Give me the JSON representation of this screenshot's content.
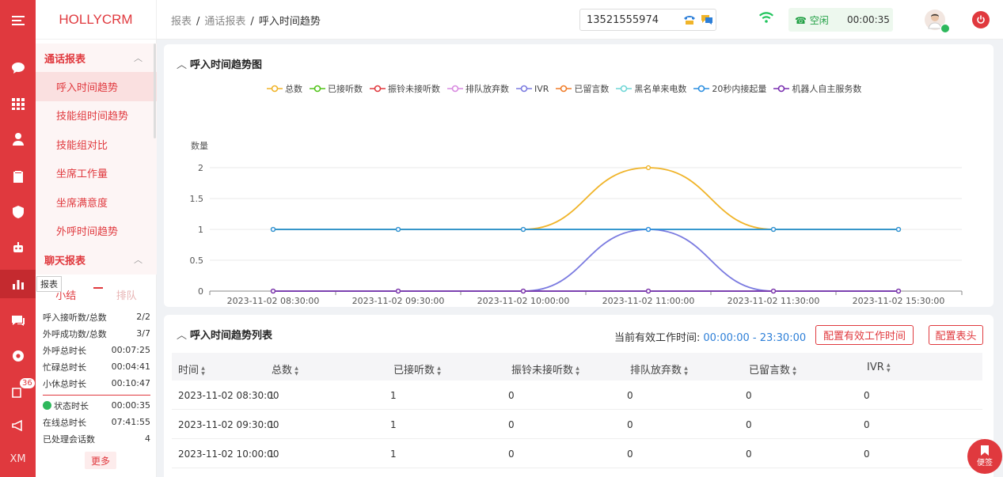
{
  "app": {
    "logo": "HOLLYCRM"
  },
  "rail": {
    "badge": "36",
    "footer": "XM"
  },
  "breadcrumb": {
    "items": [
      "报表",
      "通话报表"
    ],
    "current": "呼入时间趋势"
  },
  "topbar": {
    "phone": "13521555974",
    "status": "空闲",
    "timer": "00:00:35"
  },
  "menu": {
    "group1": "通话报表",
    "items": [
      "呼入时间趋势",
      "技能组时间趋势",
      "技能组对比",
      "坐席工作量",
      "坐席满意度",
      "外呼时间趋势"
    ],
    "group2": "聊天报表"
  },
  "tooltip": "报表",
  "summary": {
    "tabs": [
      "小结",
      "排队"
    ],
    "rows": [
      {
        "label": "呼入接听数/总数",
        "value": "2/2"
      },
      {
        "label": "外呼成功数/总数",
        "value": "3/7"
      },
      {
        "label": "外呼总时长",
        "value": "00:07:25"
      },
      {
        "label": "忙碌总时长",
        "value": "00:04:41"
      },
      {
        "label": "小休总时长",
        "value": "00:10:47"
      }
    ],
    "rows2": [
      {
        "label": "状态时长",
        "value": "00:00:35"
      },
      {
        "label": "在线总时长",
        "value": "07:41:55"
      },
      {
        "label": "已处理会话数",
        "value": "4"
      }
    ],
    "more": "更多"
  },
  "chart_panel": {
    "title": "呼入时间趋势图"
  },
  "chart_data": {
    "type": "line",
    "ylabel": "数量",
    "ylim": [
      0,
      2
    ],
    "yticks": [
      "0",
      "0.5",
      "1",
      "1.5",
      "2"
    ],
    "categories": [
      "2023-11-02 08:30:00",
      "2023-11-02 09:30:00",
      "2023-11-02 10:00:00",
      "2023-11-02 11:00:00",
      "2023-11-02 11:30:00",
      "2023-11-02 15:30:00"
    ],
    "series": [
      {
        "name": "总数",
        "color": "#f0b429",
        "values": [
          1,
          1,
          1,
          2,
          1,
          1
        ]
      },
      {
        "name": "已接听数",
        "color": "#52c41a",
        "values": [
          1,
          1,
          1,
          1,
          1,
          1
        ]
      },
      {
        "name": "振铃未接听数",
        "color": "#e0393e",
        "values": [
          0,
          0,
          0,
          0,
          0,
          0
        ]
      },
      {
        "name": "排队放弃数",
        "color": "#d88ae0",
        "values": [
          0,
          0,
          0,
          0,
          0,
          0
        ]
      },
      {
        "name": "IVR",
        "color": "#7b7be0",
        "values": [
          0,
          0,
          0,
          1,
          0,
          0
        ]
      },
      {
        "name": "已留言数",
        "color": "#f07d2a",
        "values": [
          0,
          0,
          0,
          0,
          0,
          0
        ]
      },
      {
        "name": "黑名单来电数",
        "color": "#6fd6d6",
        "values": [
          0,
          0,
          0,
          0,
          0,
          0
        ]
      },
      {
        "name": "20秒内接起量",
        "color": "#2d8fe0",
        "values": [
          1,
          1,
          1,
          1,
          1,
          1
        ]
      },
      {
        "name": "机器人自主服务数",
        "color": "#7a2fb0",
        "values": [
          0,
          0,
          0,
          0,
          0,
          0
        ]
      }
    ]
  },
  "table_panel": {
    "title": "呼入时间趋势列表",
    "worktime_label": "当前有效工作时间:",
    "worktime_value": "00:00:00 - 23:30:00",
    "btn_config_time": "配置有效工作时间",
    "btn_config_header": "配置表头",
    "columns": [
      "时间",
      "总数",
      "已接听数",
      "振铃未接听数",
      "排队放弃数",
      "已留言数",
      "IVR"
    ],
    "rows": [
      [
        "2023-11-02 08:30:00",
        "1",
        "1",
        "0",
        "0",
        "0",
        "0"
      ],
      [
        "2023-11-02 09:30:00",
        "1",
        "1",
        "0",
        "0",
        "0",
        "0"
      ],
      [
        "2023-11-02 10:00:00",
        "1",
        "1",
        "0",
        "0",
        "0",
        "0"
      ]
    ]
  },
  "note_button": "便签"
}
